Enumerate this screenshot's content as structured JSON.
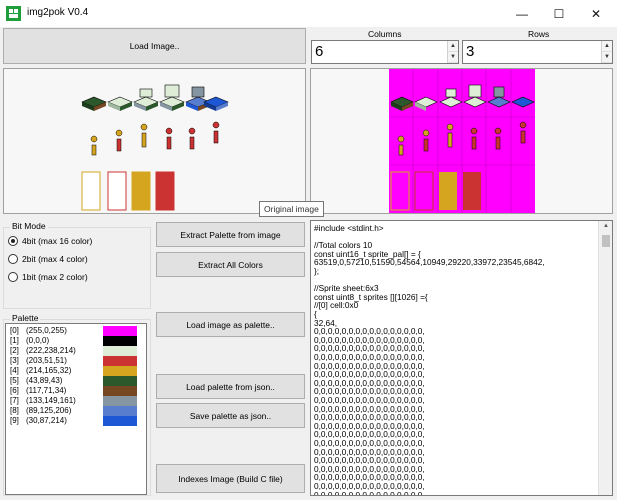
{
  "window": {
    "title": "img2pok V0.4",
    "min": "—",
    "max": "☐",
    "close": "✕"
  },
  "colors": {
    "magenta": "#ff00ff",
    "panel_bg": "#f7f7f7"
  },
  "toolbar": {
    "load_image": "Load Image..",
    "columns_label": "Columns",
    "columns_value": "6",
    "rows_label": "Rows",
    "rows_value": "3"
  },
  "tooltip": "Original image",
  "bitmode": {
    "title": "Bit Mode",
    "options": [
      {
        "label": "4bit (max 16 color)",
        "selected": true
      },
      {
        "label": "2bit (max 4 color)",
        "selected": false
      },
      {
        "label": "1bit (max 2 color)",
        "selected": false
      }
    ]
  },
  "buttons": {
    "extract_palette": "Extract Palette from image",
    "extract_all": "Extract All Colors",
    "load_image_palette": "Load image as palette..",
    "load_palette_json": "Load palette from json..",
    "save_palette_json": "Save palette as json..",
    "indexes_image": "Indexes Image (Build C file)"
  },
  "palette": {
    "title": "Palette",
    "entries": [
      {
        "idx": "[0]",
        "rgb": "(255,0,255)",
        "color": "#ff00ff"
      },
      {
        "idx": "[1]",
        "rgb": "(0,0,0)",
        "color": "#000000"
      },
      {
        "idx": "[2]",
        "rgb": "(222,238,214)",
        "color": "#deeed6"
      },
      {
        "idx": "[3]",
        "rgb": "(203,51,51)",
        "color": "#cb3333"
      },
      {
        "idx": "[4]",
        "rgb": "(214,165,32)",
        "color": "#d6a520"
      },
      {
        "idx": "[5]",
        "rgb": "(43,89,43)",
        "color": "#2b592b"
      },
      {
        "idx": "[6]",
        "rgb": "(117,71,34)",
        "color": "#754722"
      },
      {
        "idx": "[7]",
        "rgb": "(133,149,161)",
        "color": "#8595a1"
      },
      {
        "idx": "[8]",
        "rgb": "(89,125,206)",
        "color": "#597dce"
      },
      {
        "idx": "[9]",
        "rgb": "(30,87,214)",
        "color": "#1e57d6"
      }
    ]
  },
  "code": {
    "lines": [
      "#include <stdint.h>",
      "",
      "//Total colors 10",
      "const uint16_t sprite_pal[] = {",
      "63519,0,57210,51590,54564,10949,29220,33972,23545,6842,",
      "};",
      "",
      "//Sprite sheet:6x3",
      "const uint8_t sprites [][1026] ={",
      "//[0] cell:0x0",
      "{",
      "32,64,",
      "0,0,0,0,0,0,0,0,0,0,0,0,0,0,0,0,",
      "0,0,0,0,0,0,0,0,0,0,0,0,0,0,0,0,",
      "0,0,0,0,0,0,0,0,0,0,0,0,0,0,0,0,",
      "0,0,0,0,0,0,0,0,0,0,0,0,0,0,0,0,",
      "0,0,0,0,0,0,0,0,0,0,0,0,0,0,0,0,",
      "0,0,0,0,0,0,0,0,0,0,0,0,0,0,0,0,",
      "0,0,0,0,0,0,0,0,0,0,0,0,0,0,0,0,",
      "0,0,0,0,0,0,0,0,0,0,0,0,0,0,0,0,",
      "0,0,0,0,0,0,0,0,0,0,0,0,0,0,0,0,",
      "0,0,0,0,0,0,0,0,0,0,0,0,0,0,0,0,",
      "0,0,0,0,0,0,0,0,0,0,0,0,0,0,0,0,",
      "0,0,0,0,0,0,0,0,0,0,0,0,0,0,0,0,",
      "0,0,0,0,0,0,0,0,0,0,0,0,0,0,0,0,",
      "0,0,0,0,0,0,0,0,0,0,0,0,0,0,0,0,",
      "0,0,0,0,0,0,0,0,0,0,0,0,0,0,0,0,",
      "0,0,0,0,0,0,0,0,0,0,0,0,0,0,0,0,",
      "0,0,0,0,0,0,0,0,0,0,0,0,0,0,0,0,",
      "0,0,0,0,0,0,0,0,0,0,0,0,0,0,0,0,",
      "0,0,0,0,0,0,0,0,0,0,0,0,0,0,0,0,",
      "0,0,0,0,0,0,0,0,0,0,0,0,0,0,0,0,"
    ]
  }
}
